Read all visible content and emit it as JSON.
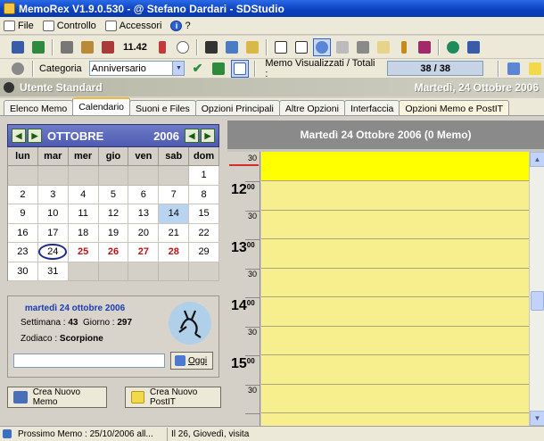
{
  "window": {
    "title": "MemoRex V1.9.0.530 - @ Stefano Dardari - SDStudio"
  },
  "menu": {
    "items": [
      {
        "label": "File",
        "icon": "file-icon"
      },
      {
        "label": "Controllo",
        "icon": "control-icon"
      },
      {
        "label": "Accessori",
        "icon": "accessories-icon"
      },
      {
        "label": "?",
        "icon": "info-icon"
      }
    ]
  },
  "toolbar": {
    "time": "11.42"
  },
  "toolbar2": {
    "category_label": "Categoria",
    "category_value": "Anniversario",
    "memo_count_label": "Memo Visualizzati / Totali :",
    "memo_count_value": "38 / 38"
  },
  "userbar": {
    "user": "Utente Standard",
    "date": "Martedì, 24 Ottobre 2006"
  },
  "tabs": [
    {
      "label": "Elenco Memo"
    },
    {
      "label": "Calendario"
    },
    {
      "label": "Suoni e Files"
    },
    {
      "label": "Opzioni Principali"
    },
    {
      "label": "Altre Opzioni"
    },
    {
      "label": "Interfaccia"
    },
    {
      "label": "Opzioni Memo e PostIT"
    }
  ],
  "calendar": {
    "month": "OTTOBRE",
    "year": "2006",
    "weekdays": [
      "lun",
      "mar",
      "mer",
      "gio",
      "ven",
      "sab",
      "dom"
    ],
    "weeks": [
      [
        "",
        "",
        "",
        "",
        "",
        "",
        "1"
      ],
      [
        "2",
        "3",
        "4",
        "5",
        "6",
        "7",
        "8"
      ],
      [
        "9",
        "10",
        "11",
        "12",
        "13",
        "14",
        "15"
      ],
      [
        "16",
        "17",
        "18",
        "19",
        "20",
        "21",
        "22"
      ],
      [
        "23",
        "24",
        "25",
        "26",
        "27",
        "28",
        "29"
      ],
      [
        "30",
        "31",
        "",
        "",
        "",
        "",
        ""
      ]
    ]
  },
  "info": {
    "date": "martedì 24 ottobre 2006",
    "week_label": "Settimana :",
    "week_value": "43",
    "day_label": "Giorno :",
    "day_value": "297",
    "zodiac_label": "Zodiaco :",
    "zodiac_value": "Scorpione",
    "today_button": "Oggi"
  },
  "buttons": {
    "new_memo": "Crea Nuovo Memo",
    "new_postit": "Crea Nuovo PostIT"
  },
  "day_view": {
    "header": "Martedì 24 Ottobre 2006  (0 Memo)",
    "half_label": "30",
    "minutes_label": "00",
    "hours": [
      "12",
      "13",
      "14",
      "15"
    ]
  },
  "status": {
    "next_memo": "Prossimo Memo : 25/10/2006 all...",
    "detail": "Il 26, Giovedì, visita"
  }
}
